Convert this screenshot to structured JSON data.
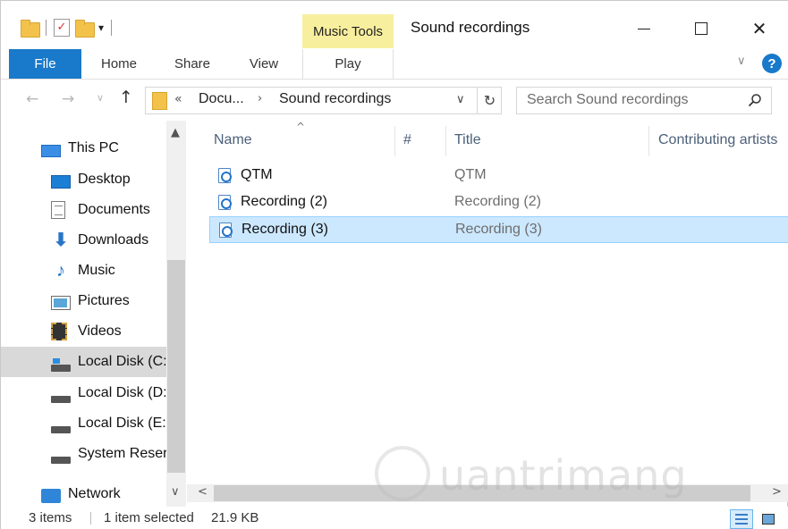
{
  "window": {
    "title": "Sound recordings",
    "contextual_tab_group": "Music Tools"
  },
  "ribbon": {
    "tabs": [
      "File",
      "Home",
      "Share",
      "View",
      "Play"
    ],
    "help_label": "?"
  },
  "address_bar": {
    "overflow_chevron": "«",
    "segments": [
      "Docu...",
      "Sound recordings"
    ],
    "separator": "›"
  },
  "search": {
    "placeholder": "Search Sound recordings"
  },
  "nav_pane": {
    "items": [
      {
        "label": "This PC",
        "icon": "this-pc-icon",
        "level": 1
      },
      {
        "label": "Desktop",
        "icon": "desktop-icon",
        "level": 2
      },
      {
        "label": "Documents",
        "icon": "documents-icon",
        "level": 2
      },
      {
        "label": "Downloads",
        "icon": "downloads-icon",
        "level": 2
      },
      {
        "label": "Music",
        "icon": "music-icon",
        "level": 2
      },
      {
        "label": "Pictures",
        "icon": "pictures-icon",
        "level": 2
      },
      {
        "label": "Videos",
        "icon": "videos-icon",
        "level": 2
      },
      {
        "label": "Local Disk (C:",
        "icon": "system-drive-icon",
        "level": 2,
        "selected": true
      },
      {
        "label": "Local Disk (D:",
        "icon": "drive-icon",
        "level": 2
      },
      {
        "label": "Local Disk (E:",
        "icon": "drive-icon",
        "level": 2
      },
      {
        "label": "System Reser",
        "icon": "drive-icon",
        "level": 2
      },
      {
        "label": "Network",
        "icon": "network-icon",
        "level": 1
      }
    ]
  },
  "file_list": {
    "columns": [
      "Name",
      "#",
      "Title",
      "Contributing artists"
    ],
    "rows": [
      {
        "name": "QTM",
        "title": "QTM",
        "selected": false
      },
      {
        "name": "Recording (2)",
        "title": "Recording (2)",
        "selected": false
      },
      {
        "name": "Recording (3)",
        "title": "Recording (3)",
        "selected": true
      }
    ]
  },
  "status_bar": {
    "item_count": "3 items",
    "selection": "1 item selected",
    "size": "21.9 KB"
  },
  "watermark": {
    "text": "uantrimang"
  },
  "colors": {
    "accent": "#1979ca",
    "selection_bg": "#cce8ff",
    "contextual_tab": "#f8ef9e"
  }
}
